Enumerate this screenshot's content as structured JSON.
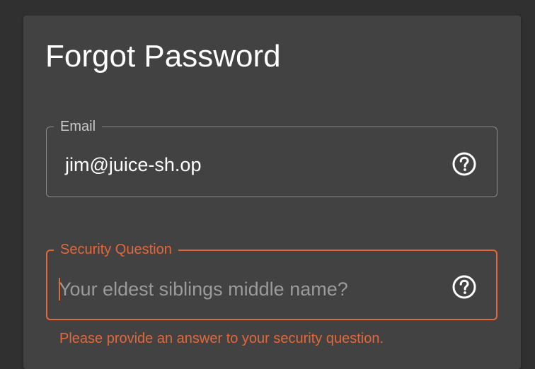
{
  "page": {
    "title": "Forgot Password"
  },
  "email_field": {
    "label": "Email",
    "value": "jim@juice-sh.op",
    "help_icon": "help-circle-icon"
  },
  "security_question_field": {
    "label": "Security Question",
    "placeholder": "Your eldest siblings middle name?",
    "value": "",
    "help_icon": "help-circle-icon",
    "error": "Please provide an answer to your security question."
  },
  "colors": {
    "background": "#303030",
    "card": "#424242",
    "text": "#ffffff",
    "outline": "#8a8a8a",
    "error_accent": "#e2683c"
  }
}
